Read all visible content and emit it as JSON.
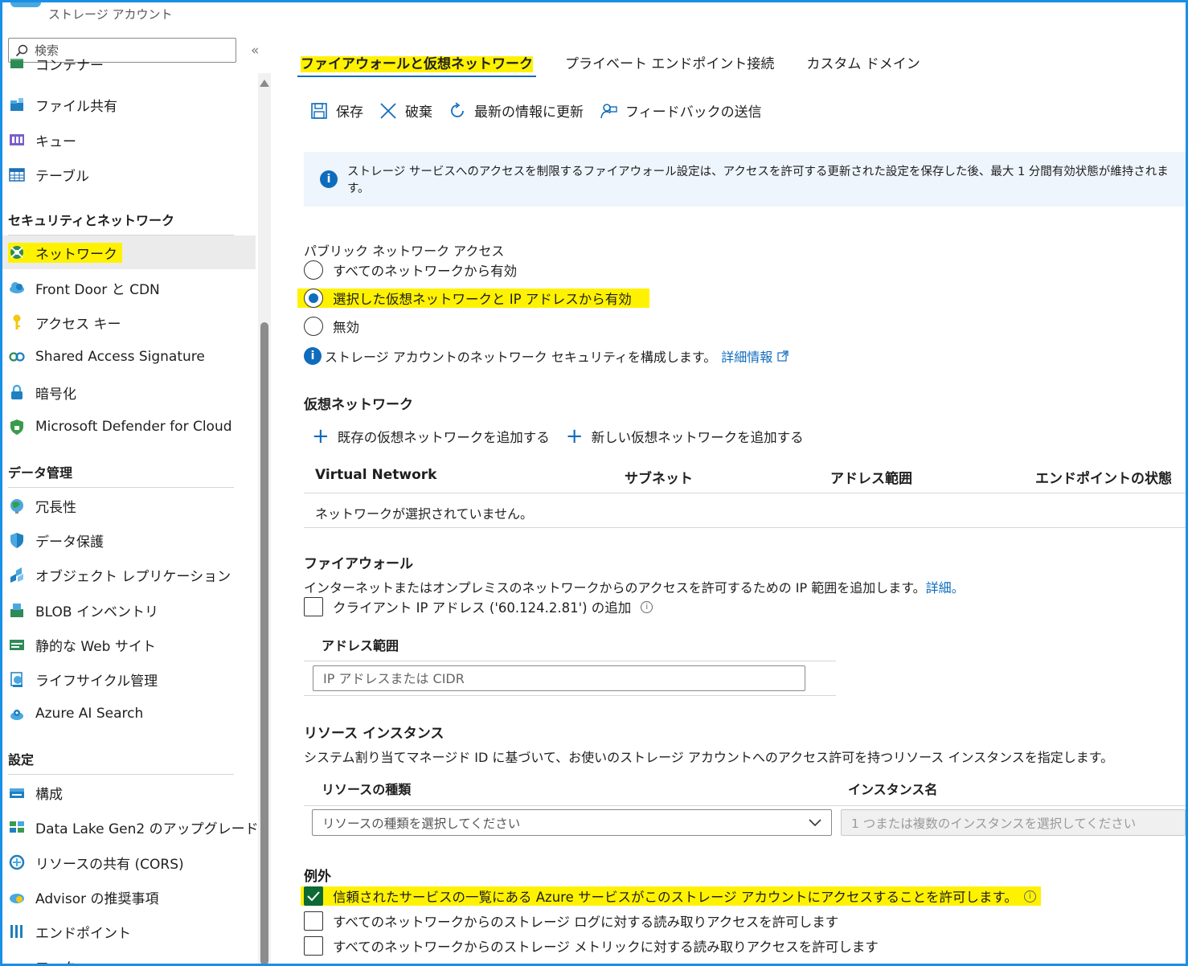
{
  "app": {
    "resource_type": "ストレージ アカウント"
  },
  "sidebar": {
    "search_placeholder": "検索",
    "collapse_label": "«",
    "items_top": [
      {
        "label": "コンテナー",
        "icon": "container-icon"
      },
      {
        "label": "ファイル共有",
        "icon": "file-share-icon"
      },
      {
        "label": "キュー",
        "icon": "queue-icon"
      },
      {
        "label": "テーブル",
        "icon": "table-icon"
      }
    ],
    "section_security": "セキュリティとネットワーク",
    "items_security": [
      {
        "label": "ネットワーク",
        "icon": "network-icon",
        "selected": true
      },
      {
        "label": "Front Door と CDN",
        "icon": "cloud-icon"
      },
      {
        "label": "アクセス キー",
        "icon": "key-icon"
      },
      {
        "label": "Shared Access Signature",
        "icon": "link-icon"
      },
      {
        "label": "暗号化",
        "icon": "lock-icon"
      },
      {
        "label": "Microsoft Defender for Cloud",
        "icon": "shield-icon"
      }
    ],
    "section_data": "データ管理",
    "items_data": [
      {
        "label": "冗長性",
        "icon": "globe-icon"
      },
      {
        "label": "データ保護",
        "icon": "shield-check-icon"
      },
      {
        "label": "オブジェクト レプリケーション",
        "icon": "replication-icon"
      },
      {
        "label": "BLOB インベントリ",
        "icon": "inventory-icon"
      },
      {
        "label": "静的な Web サイト",
        "icon": "website-icon"
      },
      {
        "label": "ライフサイクル管理",
        "icon": "lifecycle-icon"
      },
      {
        "label": "Azure AI Search",
        "icon": "search-cloud-icon"
      }
    ],
    "section_settings": "設定",
    "items_settings": [
      {
        "label": "構成",
        "icon": "config-icon"
      },
      {
        "label": "Data Lake Gen2 のアップグレード",
        "icon": "datalake-icon"
      },
      {
        "label": "リソースの共有 (CORS)",
        "icon": "cors-icon"
      },
      {
        "label": "Advisor の推奨事項",
        "icon": "advisor-icon"
      },
      {
        "label": "エンドポイント",
        "icon": "endpoint-icon"
      },
      {
        "label": "ロック",
        "icon": "lock-icon"
      }
    ]
  },
  "tabs": [
    {
      "label": "ファイアウォールと仮想ネットワーク",
      "active": true
    },
    {
      "label": "プライベート エンドポイント接続",
      "active": false
    },
    {
      "label": "カスタム ドメイン",
      "active": false
    }
  ],
  "toolbar": {
    "save": "保存",
    "discard": "破棄",
    "refresh": "最新の情報に更新",
    "feedback": "フィードバックの送信"
  },
  "info_banner": "ストレージ サービスへのアクセスを制限するファイアウォール設定は、アクセスを許可する更新された設定を保存した後、最大 1 分間有効状態が維持されます。",
  "public_access": {
    "label": "パブリック ネットワーク アクセス",
    "options": [
      {
        "label": "すべてのネットワークから有効",
        "selected": false
      },
      {
        "label": "選択した仮想ネットワークと IP アドレスから有効",
        "selected": true
      },
      {
        "label": "無効",
        "selected": false
      }
    ],
    "note": "ストレージ アカウントのネットワーク セキュリティを構成します。",
    "note_link": "詳細情報"
  },
  "vnet": {
    "heading": "仮想ネットワーク",
    "add_existing": "既存の仮想ネットワークを追加する",
    "add_new": "新しい仮想ネットワークを追加する",
    "columns": [
      "Virtual Network",
      "サブネット",
      "アドレス範囲",
      "エンドポイントの状態"
    ],
    "empty": "ネットワークが選択されていません。"
  },
  "firewall": {
    "heading": "ファイアウォール",
    "description": "インターネットまたはオンプレミスのネットワークからのアクセスを許可するための IP 範囲を追加します。",
    "description_link": "詳細。",
    "client_ip_label": "クライアント IP アドレス ('60.124.2.81') の追加",
    "client_ip_checked": false,
    "address_range_header": "アドレス範囲",
    "address_placeholder": "IP アドレスまたは CIDR"
  },
  "resource_instances": {
    "heading": "リソース インスタンス",
    "description": "システム割り当てマネージド ID に基づいて、お使いのストレージ アカウントへのアクセス許可を持つリソース インスタンスを指定します。",
    "col_type": "リソースの種類",
    "col_instance": "インスタンス名",
    "type_placeholder": "リソースの種類を選択してください",
    "instance_placeholder": "1 つまたは複数のインスタンスを選択してください"
  },
  "exceptions": {
    "heading": "例外",
    "items": [
      {
        "label": "信頼されたサービスの一覧にある Azure サービスがこのストレージ アカウントにアクセスすることを許可します。",
        "checked": true
      },
      {
        "label": "すべてのネットワークからのストレージ ログに対する読み取りアクセスを許可します",
        "checked": false
      },
      {
        "label": "すべてのネットワークからのストレージ メトリックに対する読み取りアクセスを許可します",
        "checked": false
      }
    ]
  },
  "colors": {
    "accent": "#0f6cbd",
    "highlight": "#fff200",
    "frame": "#1a8fe6",
    "checked": "#0e6a33"
  }
}
